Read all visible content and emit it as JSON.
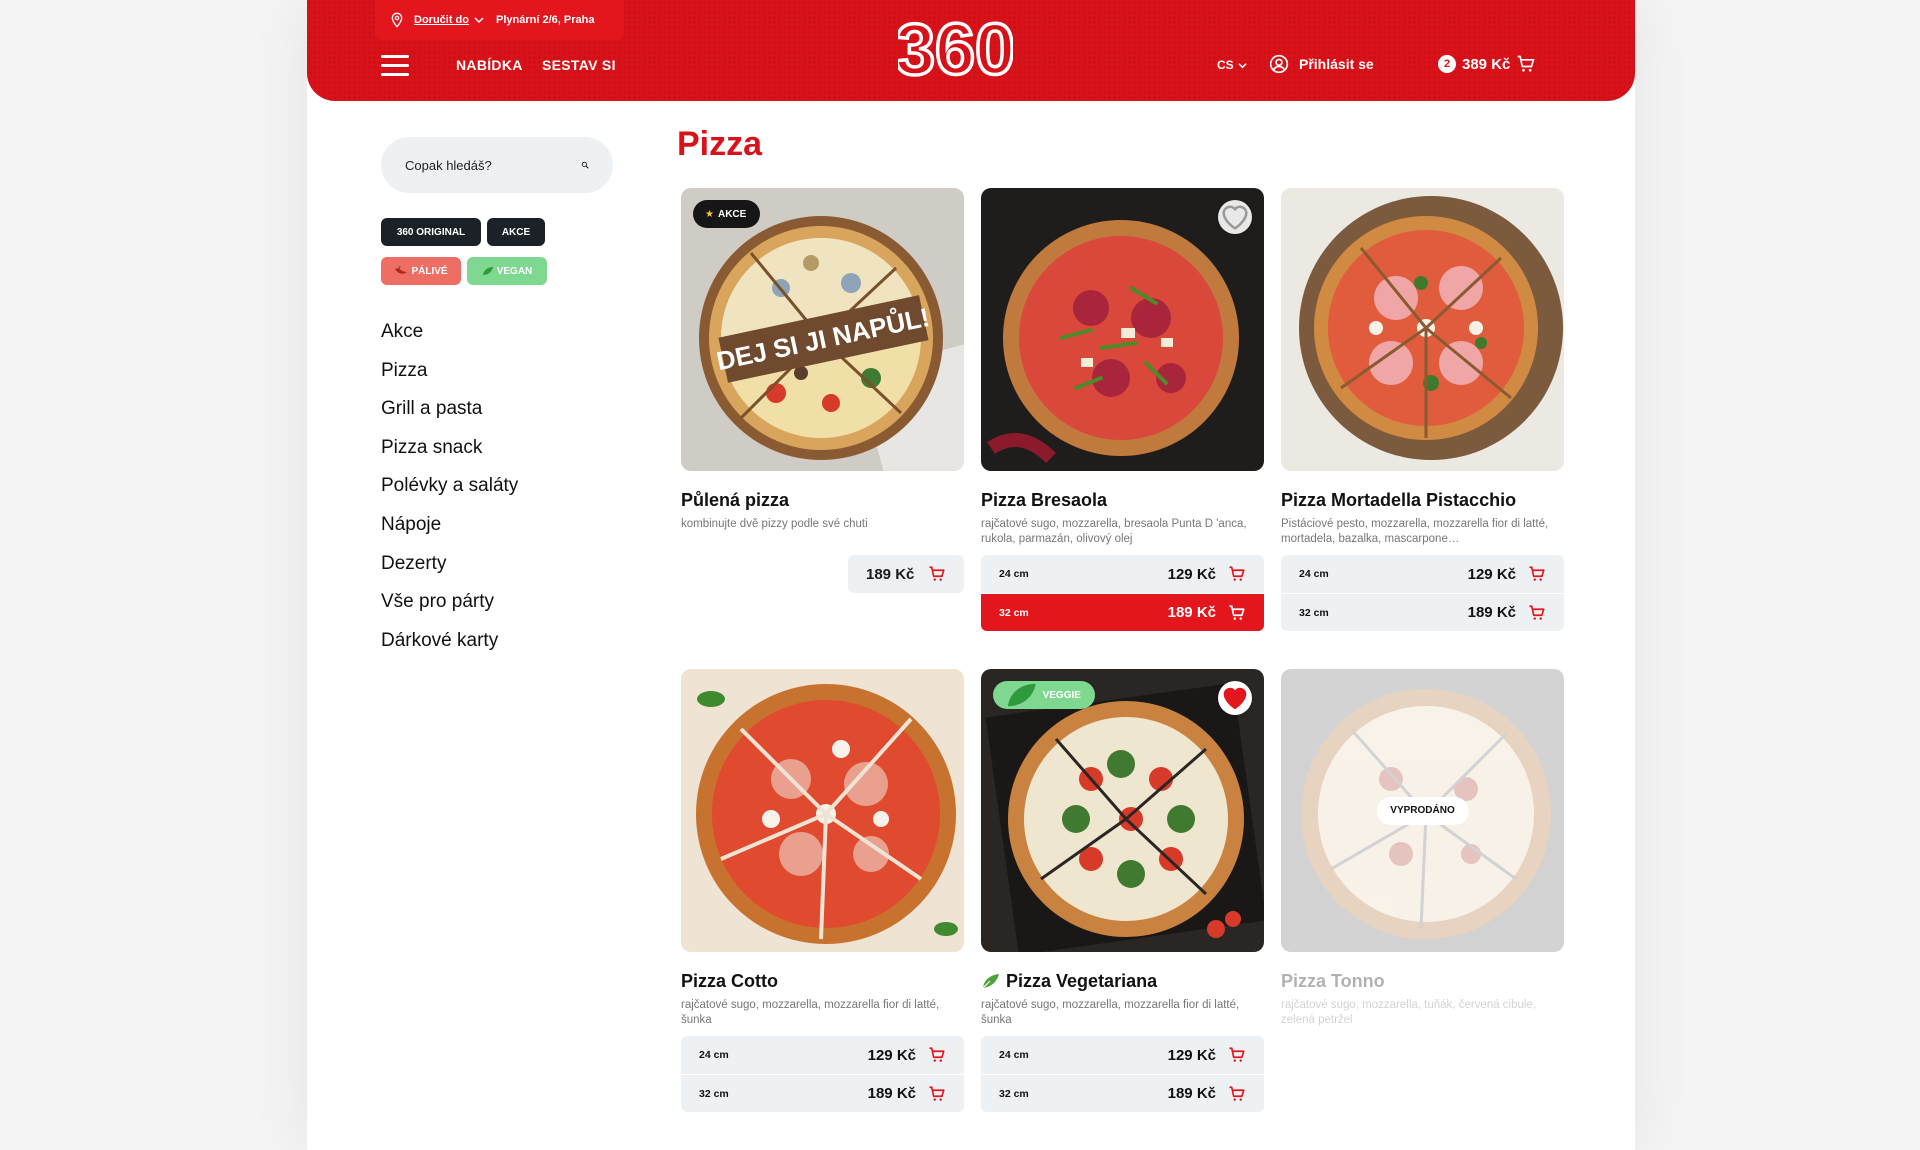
{
  "header": {
    "deliver_label": "Doručit do",
    "deliver_address": "Plynární 2/6, Praha",
    "nav": [
      "NABÍDKA",
      "SESTAV SI"
    ],
    "logo_text": "360",
    "lang": "CS",
    "login_label": "Přihlásit se",
    "cart_count": "2",
    "cart_total": "389 Kč"
  },
  "sidebar": {
    "search_placeholder": "Copak hledáš?",
    "tags": [
      "360 ORIGINAL",
      "AKCE",
      "PÁLIVÉ",
      "VEGAN"
    ],
    "categories": [
      "Akce",
      "Pizza",
      "Grill a pasta",
      "Pizza snack",
      "Polévky a saláty",
      "Nápoje",
      "Dezerty",
      "Vše pro párty",
      "Dárkové karty"
    ]
  },
  "main": {
    "title": "Pizza",
    "products": [
      {
        "name": "Půlená pizza",
        "desc": "kombinujte dvě pizzy podle své chuti",
        "badge": "AKCE",
        "overlay_text": "DEJ SI JI NAPŮL!",
        "price": "189 Kč"
      },
      {
        "name": "Pizza Bresaola",
        "desc": "rajčatové sugo, mozzarella, bresaola Punta D 'anca, rukola, parmazán, olivový olej",
        "sizes": [
          {
            "size": "24 cm",
            "price": "129 Kč"
          },
          {
            "size": "32 cm",
            "price": "189 Kč"
          }
        ]
      },
      {
        "name": "Pizza Mortadella Pistacchio",
        "desc": "Pistáciové pesto, mozzarella, mozzarella fior di latté, mortadela, bazalka, mascarpone…",
        "sizes": [
          {
            "size": "24 cm",
            "price": "129 Kč"
          },
          {
            "size": "32 cm",
            "price": "189 Kč"
          }
        ]
      },
      {
        "name": "Pizza Cotto",
        "desc": "rajčatové sugo, mozzarella, mozzarella fior di latté, šunka",
        "sizes": [
          {
            "size": "24 cm",
            "price": "129 Kč"
          },
          {
            "size": "32 cm",
            "price": "189 Kč"
          }
        ]
      },
      {
        "name": "Pizza Vegetariana",
        "desc": "rajčatové sugo, mozzarella, mozzarella fior di latté, šunka",
        "badge": "VEGGIE",
        "sizes": [
          {
            "size": "24 cm",
            "price": "129 Kč"
          },
          {
            "size": "32 cm",
            "price": "189 Kč"
          }
        ]
      },
      {
        "name": "Pizza Tonno",
        "desc": "rajčatové sugo, mozzarella, tuňák, červená cibule, zelená petržel",
        "status": "VYPRODÁNO"
      }
    ]
  },
  "colors": {
    "brand_red": "#d9121a",
    "dark": "#1c2127",
    "veggie_green": "#7fd88f",
    "hot_red": "#ee6e63",
    "panel": "#eef1f3"
  }
}
